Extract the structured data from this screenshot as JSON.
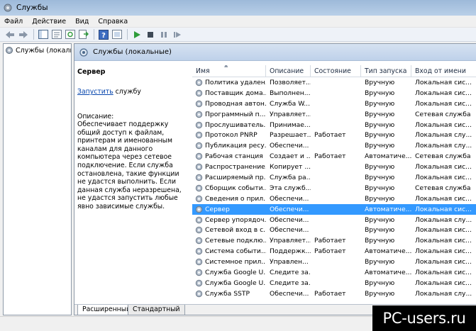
{
  "window": {
    "title": "Службы"
  },
  "menu": {
    "items": [
      "Файл",
      "Действие",
      "Вид",
      "Справка"
    ]
  },
  "tree": {
    "root_label": "Службы (локальные)"
  },
  "content": {
    "header_label": "Службы (локальные)"
  },
  "description": {
    "service_name": "Сервер",
    "start_link": "Запустить",
    "start_suffix": " службу",
    "desc_label": "Описание:",
    "desc_text": "Обеспечивает поддержку общий доступ к файлам, принтерам и именованным каналам для данного компьютера через сетевое подключение. Если служба остановлена, такие функции не удастся выполнить. Если данная служба неразрешена, не удастся запустить любые явно зависимые службы."
  },
  "table": {
    "columns": [
      "Имя",
      "Описание",
      "Состояние",
      "Тип запуска",
      "Вход от имени"
    ],
    "selected_index": 13,
    "rows": [
      {
        "name": "Политика удален...",
        "desc": "Позволяет...",
        "status": "",
        "startup": "Вручную",
        "logon": "Локальная сис..."
      },
      {
        "name": "Поставщик дома...",
        "desc": "Выполнен...",
        "status": "",
        "startup": "Вручную",
        "logon": "Локальная сис..."
      },
      {
        "name": "Проводная автон...",
        "desc": "Служба W...",
        "status": "",
        "startup": "Вручную",
        "logon": "Локальная сис..."
      },
      {
        "name": "Программный п...",
        "desc": "Управляет...",
        "status": "",
        "startup": "Вручную",
        "logon": "Сетевая служба"
      },
      {
        "name": "Прослушиватель...",
        "desc": "Принимае...",
        "status": "",
        "startup": "Вручную",
        "logon": "Локальная сис..."
      },
      {
        "name": "Протокол PNRP",
        "desc": "Разрешает...",
        "status": "Работает",
        "startup": "Вручную",
        "logon": "Локальная слу..."
      },
      {
        "name": "Публикация ресу...",
        "desc": "Обеспечи...",
        "status": "",
        "startup": "Вручную",
        "logon": "Локальная слу..."
      },
      {
        "name": "Рабочая станция",
        "desc": "Создает и ...",
        "status": "Работает",
        "startup": "Автоматиче...",
        "logon": "Сетевая служба"
      },
      {
        "name": "Распространение...",
        "desc": "Копирует ...",
        "status": "",
        "startup": "Вручную",
        "logon": "Локальная сис..."
      },
      {
        "name": "Расширяемый пр...",
        "desc": "Служба ра...",
        "status": "",
        "startup": "Вручную",
        "logon": "Локальная сис..."
      },
      {
        "name": "Сборщик событи...",
        "desc": "Эта служб...",
        "status": "",
        "startup": "Вручную",
        "logon": "Сетевая служба"
      },
      {
        "name": "Сведения о прил...",
        "desc": "Обеспечи...",
        "status": "",
        "startup": "Вручную",
        "logon": "Локальная сис..."
      },
      {
        "name": "Сервер",
        "desc": "Обеспечи...",
        "status": "",
        "startup": "Автоматиче...",
        "logon": "Локальная сис..."
      },
      {
        "name": "Сервер упорядоч...",
        "desc": "Обеспечи...",
        "status": "",
        "startup": "Вручную",
        "logon": "Локальная слу..."
      },
      {
        "name": "Сетевой вход в с...",
        "desc": "Обеспечи...",
        "status": "",
        "startup": "Вручную",
        "logon": "Локальная сис..."
      },
      {
        "name": "Сетевые подклю...",
        "desc": "Управляет...",
        "status": "Работает",
        "startup": "Вручную",
        "logon": "Локальная сис..."
      },
      {
        "name": "Система событи...",
        "desc": "Поддержк...",
        "status": "Работает",
        "startup": "Автоматиче...",
        "logon": "Локальная сис..."
      },
      {
        "name": "Системное прил...",
        "desc": "Управлен...",
        "status": "",
        "startup": "Вручную",
        "logon": "Локальная сис..."
      },
      {
        "name": "Служба Google U...",
        "desc": "Следите за...",
        "status": "",
        "startup": "Автоматиче...",
        "logon": "Локальная сис..."
      },
      {
        "name": "Служба Google U...",
        "desc": "Следите за...",
        "status": "",
        "startup": "Вручную",
        "logon": "Локальная сис..."
      },
      {
        "name": "Служба SSTP",
        "desc": "Обеспечи...",
        "status": "Работает",
        "startup": "Вручную",
        "logon": "Локальная слу..."
      }
    ]
  },
  "tabs": [
    "Расширенный",
    "Стандартный"
  ],
  "watermark": "PC-users.ru",
  "colors": {
    "selection": "#3399ff",
    "link": "#0645ad",
    "header": "#bfd1ea"
  }
}
